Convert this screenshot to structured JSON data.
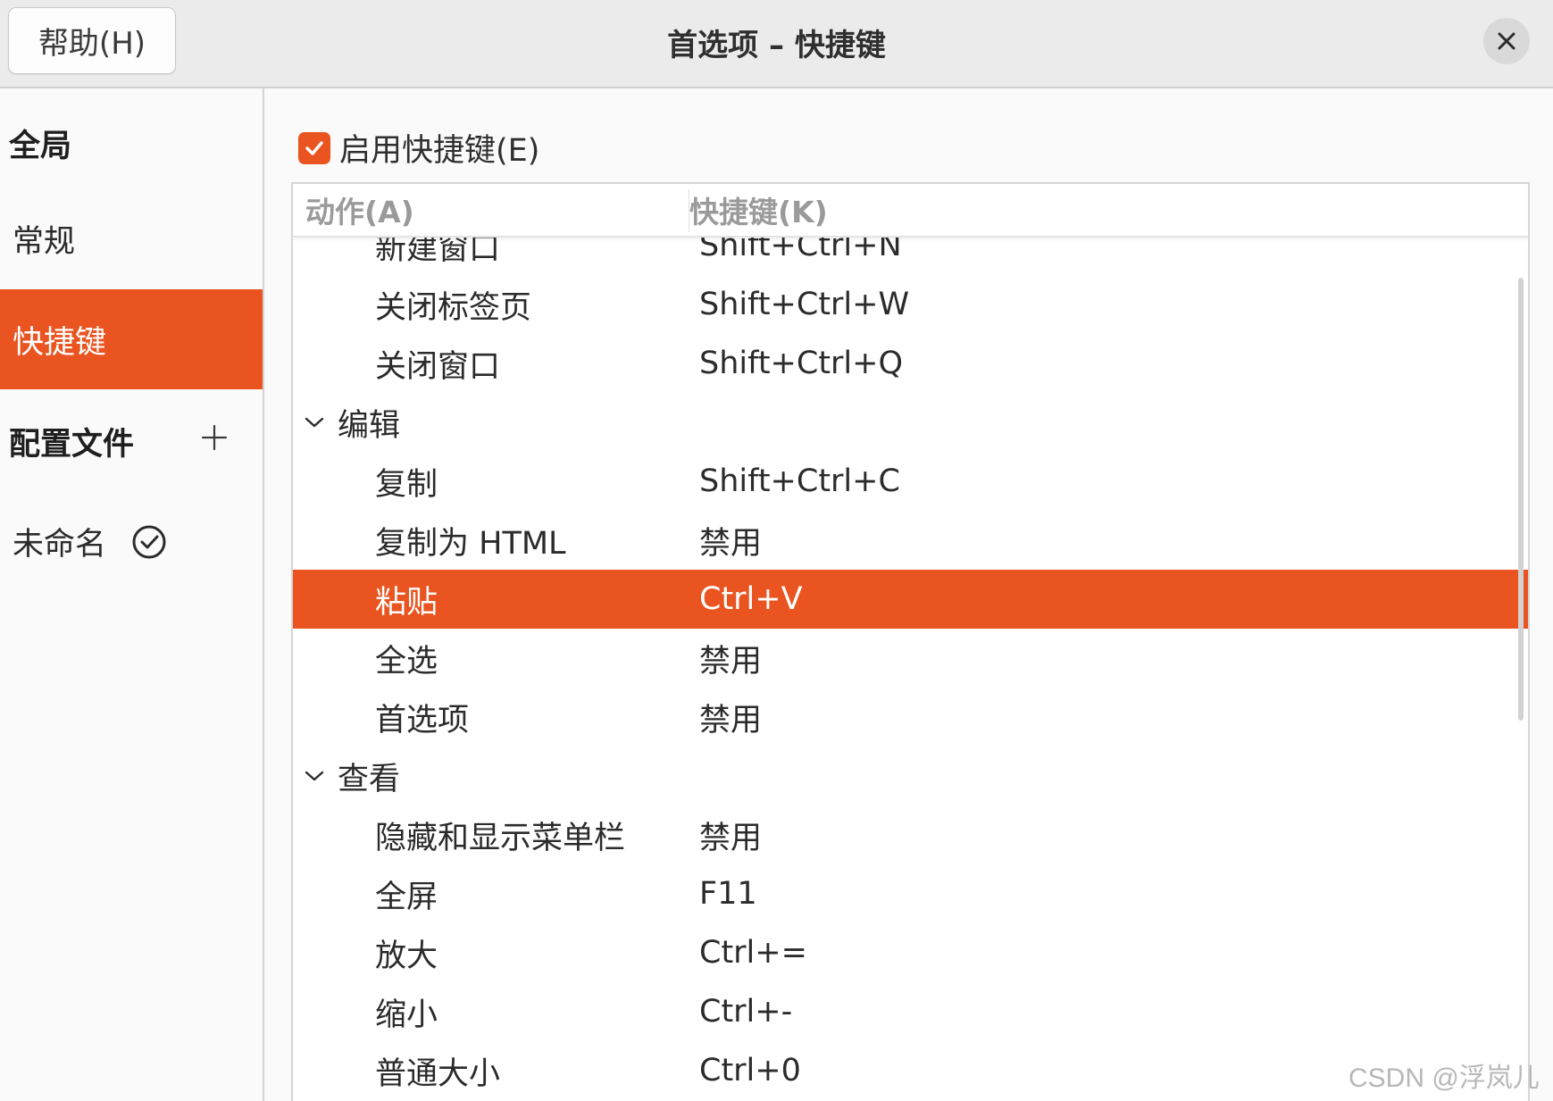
{
  "header": {
    "help_label": "帮助(H)",
    "title": "首选项 – 快捷键",
    "close_icon": "close-icon"
  },
  "sidebar": {
    "global_heading": "全局",
    "items": [
      {
        "label": "常规",
        "active": false
      },
      {
        "label": "快捷键",
        "active": true
      }
    ],
    "profiles_heading": "配置文件",
    "add_icon": "plus-icon",
    "profiles": [
      {
        "label": "未命名",
        "default_icon": "check-circle-icon"
      }
    ]
  },
  "main": {
    "enable_shortcuts_label": "启用快捷键(E)",
    "enable_shortcuts_checked": true,
    "table": {
      "columns": [
        "动作(A)",
        "快捷键(K)"
      ],
      "rows": [
        {
          "type": "item",
          "action": "新建窗口",
          "shortcut": "Shift+Ctrl+N"
        },
        {
          "type": "item",
          "action": "关闭标签页",
          "shortcut": "Shift+Ctrl+W"
        },
        {
          "type": "item",
          "action": "关闭窗口",
          "shortcut": "Shift+Ctrl+Q"
        },
        {
          "type": "group",
          "action": "编辑",
          "shortcut": ""
        },
        {
          "type": "item",
          "action": "复制",
          "shortcut": "Shift+Ctrl+C"
        },
        {
          "type": "item",
          "action": "复制为 HTML",
          "shortcut": "禁用"
        },
        {
          "type": "item",
          "action": "粘贴",
          "shortcut": "Ctrl+V",
          "selected": true
        },
        {
          "type": "item",
          "action": "全选",
          "shortcut": "禁用"
        },
        {
          "type": "item",
          "action": "首选项",
          "shortcut": "禁用"
        },
        {
          "type": "group",
          "action": "查看",
          "shortcut": ""
        },
        {
          "type": "item",
          "action": "隐藏和显示菜单栏",
          "shortcut": "禁用"
        },
        {
          "type": "item",
          "action": "全屏",
          "shortcut": "F11"
        },
        {
          "type": "item",
          "action": "放大",
          "shortcut": "Ctrl+="
        },
        {
          "type": "item",
          "action": "缩小",
          "shortcut": "Ctrl+-"
        },
        {
          "type": "item",
          "action": "普通大小",
          "shortcut": "Ctrl+0"
        }
      ]
    }
  },
  "watermark": "CSDN @浮岚儿",
  "colors": {
    "accent": "#e95420",
    "header_bg": "#ebebeb",
    "column_header_text": "#9a9a9a"
  }
}
